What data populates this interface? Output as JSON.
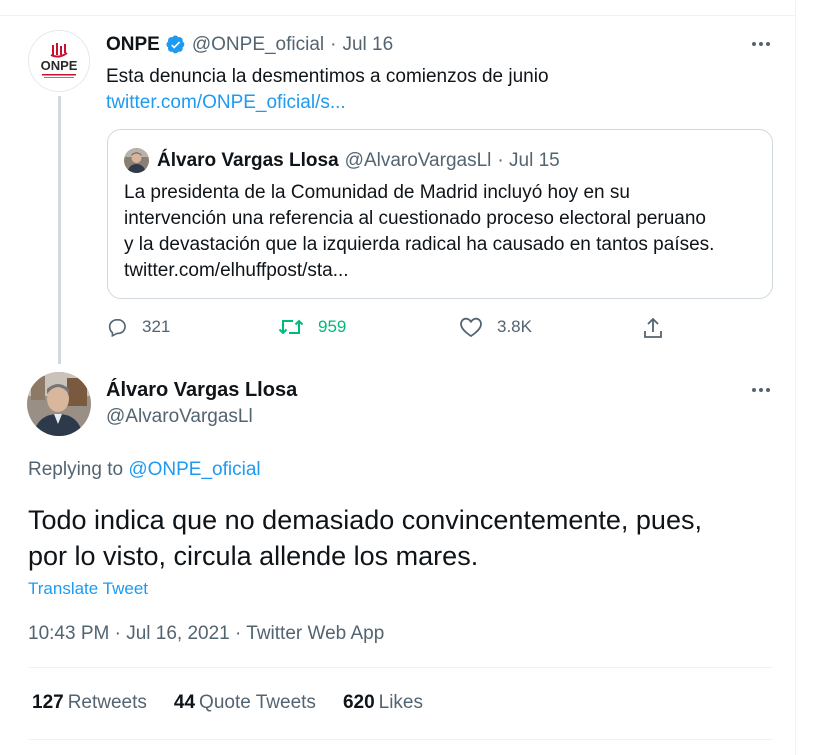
{
  "parent_tweet": {
    "author_name": "ONPE",
    "handle": "@ONPE_oficial",
    "date_sep": "·",
    "date": "Jul 16",
    "logo_text": "ONPE",
    "text": "Esta denuncia la desmentimos a comienzos de junio",
    "link": "twitter.com/ONPE_oficial/s...",
    "quote": {
      "author_name": "Álvaro Vargas Llosa",
      "handle": "@AlvaroVargasLl",
      "date": "· Jul 15",
      "text_lines": [
        "La presidenta de la Comunidad de Madrid incluyó hoy en su",
        "intervención una referencia al cuestionado proceso electoral peruano",
        "y la devastación que la izquierda radical ha causado en tantos países.",
        "twitter.com/elhuffpost/sta..."
      ]
    },
    "actions": {
      "replies": "321",
      "retweets": "959",
      "likes": "3.8K"
    },
    "more_icon": "more-dots-icon"
  },
  "main_tweet": {
    "author_name": "Álvaro Vargas Llosa",
    "handle": "@AlvaroVargasLl",
    "replying_label": "Replying to",
    "replying_to": "@ONPE_oficial",
    "text_lines": [
      "Todo indica que no demasiado convincentemente, pues,",
      "por lo visto, circula allende los mares."
    ],
    "translate_label": "Translate Tweet",
    "meta": "10:43 PM · Jul 16, 2021 · Twitter Web App",
    "stats": {
      "retweets_count": "127",
      "retweets_label": "Retweets",
      "quotes_count": "44",
      "quotes_label": "Quote Tweets",
      "likes_count": "620",
      "likes_label": "Likes"
    }
  },
  "colors": {
    "accent": "#1d9bf0",
    "retweet_green": "#00ba7c",
    "muted": "#536471",
    "border": "#cfd9de"
  }
}
